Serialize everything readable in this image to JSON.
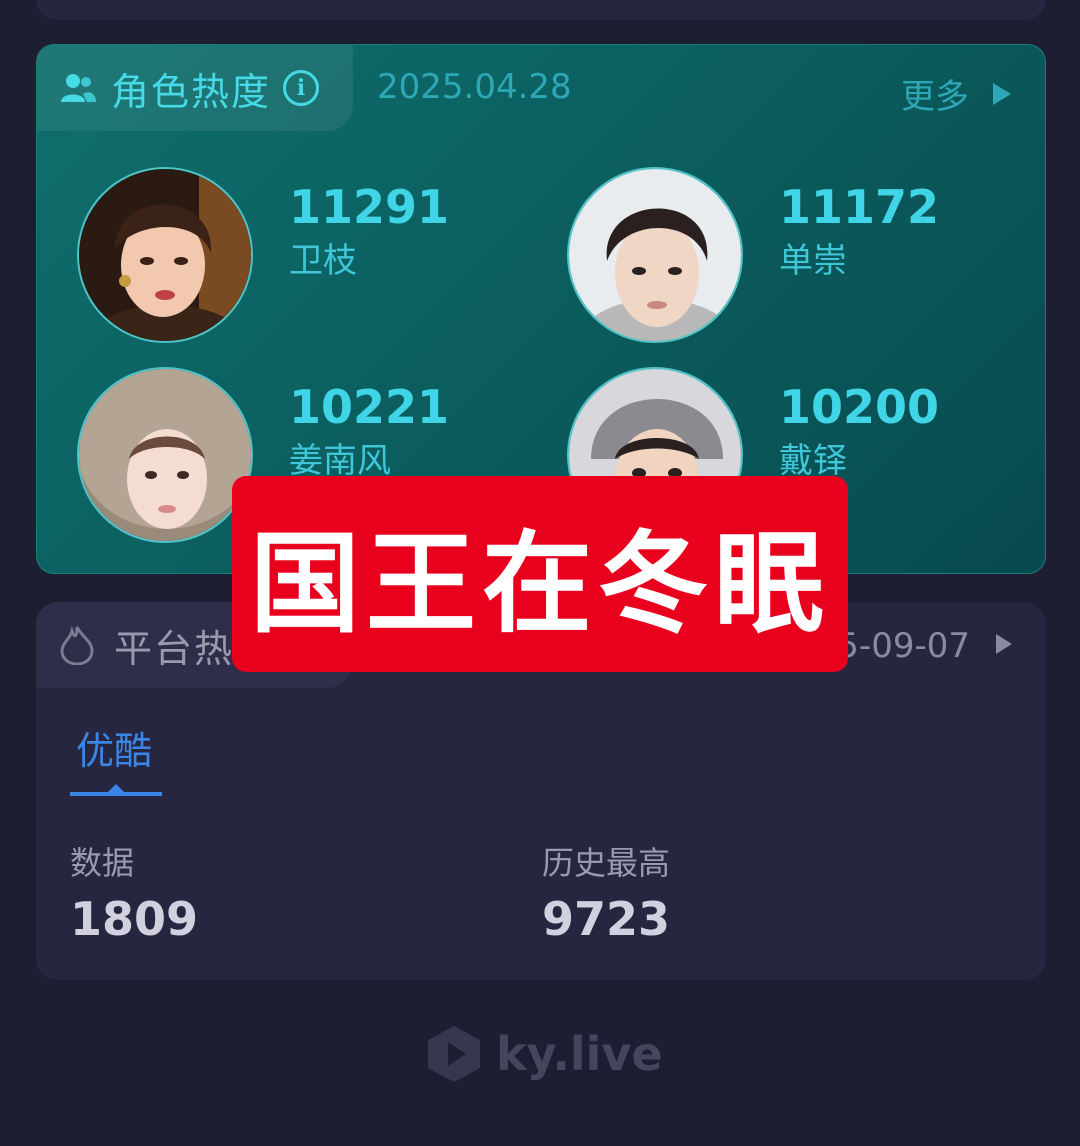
{
  "role_card": {
    "title": "角色热度",
    "date": "2025.04.28",
    "more_label": "更多",
    "accent": "#46d9e6",
    "roles": [
      {
        "score": "11291",
        "name": "卫枝"
      },
      {
        "score": "11172",
        "name": "单崇"
      },
      {
        "score": "10221",
        "name": "姜南风"
      },
      {
        "score": "10200",
        "name": "戴铎"
      }
    ]
  },
  "platform_card": {
    "title": "平台热",
    "date": "5-09-07",
    "active_tab": "优酷",
    "tab_color": "#3a86e6",
    "data_label": "数据",
    "data_value": "1809",
    "history_label": "历史最高",
    "history_value": "9723"
  },
  "banner": {
    "text": "国王在冬眠",
    "color": "#e8001c"
  },
  "footer": {
    "logo_text": "ky.live"
  },
  "icons": [
    "user-group-icon",
    "info-icon",
    "play-icon",
    "flame-icon",
    "ky-logo-icon"
  ]
}
